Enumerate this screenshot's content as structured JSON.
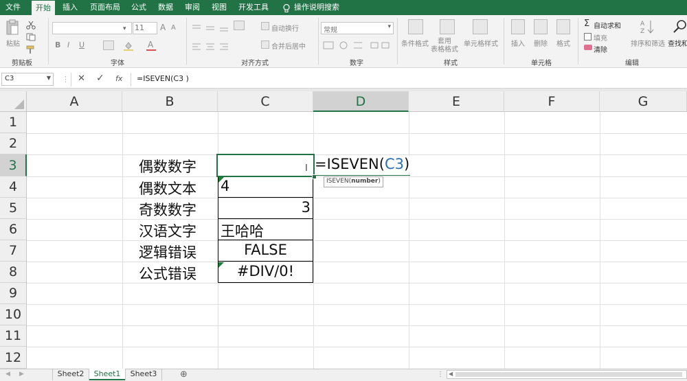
{
  "ribbon_tabs": [
    "文件",
    "开始",
    "插入",
    "页面布局",
    "公式",
    "数据",
    "审阅",
    "视图",
    "开发工具"
  ],
  "active_tab": "开始",
  "tell_me": "操作说明搜索",
  "ribbon": {
    "clipboard": {
      "paste": "粘贴",
      "group": "剪贴板"
    },
    "font": {
      "size": "11",
      "bold": "B",
      "italic": "I",
      "underline": "U",
      "grow": "A",
      "shrink": "A",
      "font_color": "A",
      "group": "字体"
    },
    "alignment": {
      "wrap": "自动换行",
      "merge": "合并后居中",
      "group": "对齐方式"
    },
    "number": {
      "format": "常规",
      "group": "数字"
    },
    "styles": {
      "conditional": "条件格式",
      "table_format": "套用\n表格格式",
      "cell_styles": "单元格样式",
      "group": "样式"
    },
    "cells": {
      "insert": "插入",
      "delete": "删除",
      "format": "格式",
      "group": "单元格"
    },
    "editing": {
      "autosum": "自动求和",
      "fill": "填充",
      "clear": "清除",
      "sort": "排序和筛选",
      "find": "查找和",
      "group": "编辑"
    }
  },
  "formula_bar": {
    "name_box": "C3",
    "fx": "fx",
    "formula": "=ISEVEN(C3 )"
  },
  "columns": [
    "A",
    "B",
    "C",
    "D",
    "E",
    "F",
    "G"
  ],
  "rows": [
    "1",
    "2",
    "3",
    "4",
    "5",
    "6",
    "7",
    "8",
    "9",
    "10",
    "11",
    "12"
  ],
  "cells": {
    "B3": "偶数数字",
    "B4": "偶数文本",
    "B5": "奇数数字",
    "B6": "汉语文字",
    "B7": "逻辑错误",
    "B8": "公式错误",
    "C4": "4",
    "C5": "3",
    "C6": "王哈哈",
    "C7": "FALSE",
    "C8": "#DIV/0!"
  },
  "editing_cell": {
    "prefix": "=ISEVEN(",
    "ref": "C3",
    "suffix": ")",
    "ref_color": "#2e6fb0"
  },
  "tooltip": {
    "func": "ISEVEN(",
    "arg": "number",
    ")": ")"
  },
  "sheets": [
    "Sheet2",
    "Sheet1",
    "Sheet3"
  ],
  "active_sheet": "Sheet1",
  "add_sheet": "⊕",
  "colors": {
    "brand": "#217346",
    "selection": "#217346",
    "error_marker": "#1e7e34"
  }
}
